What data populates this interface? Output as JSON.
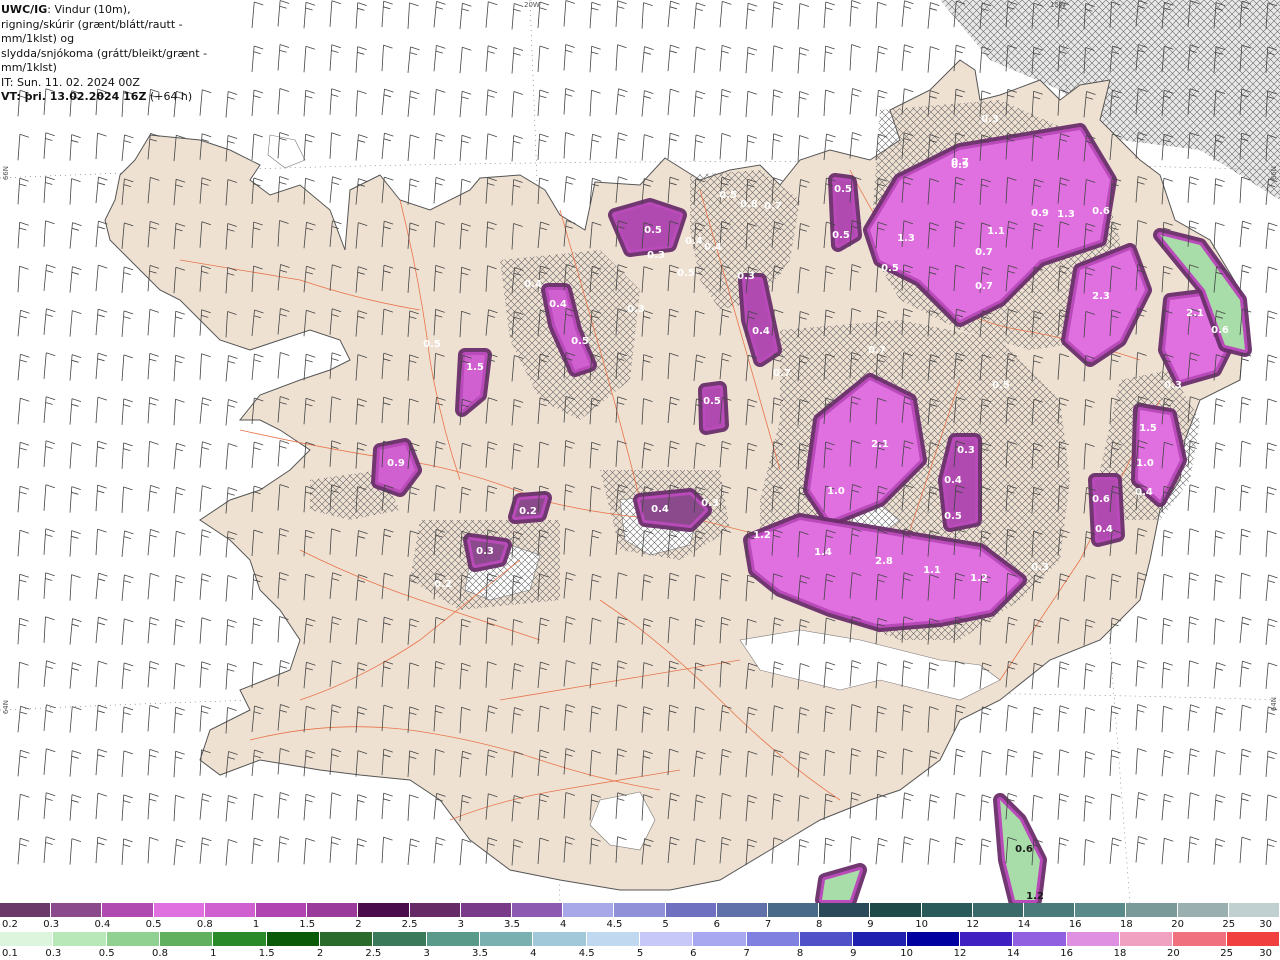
{
  "info": {
    "product": "UWC/IG",
    "line1_rest": ": Vindur (10m),",
    "line2": "rigning/skúrir (grænt/blátt/rautt - mm/1klst) og",
    "line3": "slydda/snjókoma (grátt/bleikt/grænt - mm/1klst)",
    "line4": "IT: Sun. 11. 02. 2024 00Z",
    "vt_label": "VT: þri. 13.02.2024 16Z",
    "vt_offset": " (+64 h)"
  },
  "grid_labels": {
    "lon_20w": "20W",
    "lon_15w": "15W",
    "lat_66n_left": "66N",
    "lat_66n_right": "66N",
    "lat_64n_left": "64N",
    "lat_64n_right": "64N"
  },
  "colors": {
    "land": "#efe1d2",
    "sea": "#ffffff",
    "coast": "#555555",
    "roads": "#e8744a",
    "snow_heavy": "#6b2e6b",
    "snow_mid": "#b94ab9",
    "snow_light": "#f07af0",
    "rain_light": "#a8dca8"
  },
  "precip_labels": [
    {
      "text": "0.3",
      "kind": "snow"
    },
    {
      "text": "0.9",
      "kind": "snow"
    },
    {
      "text": "0.7",
      "kind": "snow"
    },
    {
      "text": "1.1",
      "kind": "snow"
    },
    {
      "text": "1.3",
      "kind": "snow"
    },
    {
      "text": "0.9",
      "kind": "snow"
    },
    {
      "text": "0.6",
      "kind": "snow"
    },
    {
      "text": "1.3",
      "kind": "snow"
    },
    {
      "text": "0.5",
      "kind": "snow"
    },
    {
      "text": "0.7",
      "kind": "snow"
    },
    {
      "text": "0.7",
      "kind": "snow"
    },
    {
      "text": "2.3",
      "kind": "snow"
    },
    {
      "text": "2.1",
      "kind": "snow"
    },
    {
      "text": "0.6",
      "kind": "snow"
    },
    {
      "text": "0.3",
      "kind": "snow"
    },
    {
      "text": "0.7",
      "kind": "snow"
    },
    {
      "text": "2.1",
      "kind": "snow"
    },
    {
      "text": "1.0",
      "kind": "snow"
    },
    {
      "text": "0.3",
      "kind": "snow"
    },
    {
      "text": "0.4",
      "kind": "snow"
    },
    {
      "text": "0.5",
      "kind": "snow"
    },
    {
      "text": "1.5",
      "kind": "snow"
    },
    {
      "text": "1.0",
      "kind": "snow"
    },
    {
      "text": "0.4",
      "kind": "snow"
    },
    {
      "text": "0.6",
      "kind": "snow"
    },
    {
      "text": "0.4",
      "kind": "snow"
    },
    {
      "text": "1.2",
      "kind": "snow"
    },
    {
      "text": "1.4",
      "kind": "snow"
    },
    {
      "text": "2.8",
      "kind": "snow"
    },
    {
      "text": "1.1",
      "kind": "snow"
    },
    {
      "text": "1.2",
      "kind": "snow"
    },
    {
      "text": "0.3",
      "kind": "snow"
    },
    {
      "text": "0.5",
      "kind": "snow"
    },
    {
      "text": "0.8",
      "kind": "snow"
    },
    {
      "text": "0.7",
      "kind": "snow"
    },
    {
      "text": "0.5",
      "kind": "snow"
    },
    {
      "text": "0.5",
      "kind": "snow"
    },
    {
      "text": "0.3",
      "kind": "snow"
    },
    {
      "text": "0.4",
      "kind": "snow"
    },
    {
      "text": "0.4",
      "kind": "snow"
    },
    {
      "text": "0.5",
      "kind": "snow"
    },
    {
      "text": "0.3",
      "kind": "snow"
    },
    {
      "text": "0.5",
      "kind": "snow"
    },
    {
      "text": "0.3",
      "kind": "snow"
    },
    {
      "text": "0.5",
      "kind": "snow"
    },
    {
      "text": "0.4",
      "kind": "snow"
    },
    {
      "text": "0.7",
      "kind": "snow"
    },
    {
      "text": "0.3",
      "kind": "snow"
    },
    {
      "text": "0.4",
      "kind": "snow"
    },
    {
      "text": "0.2",
      "kind": "snow"
    },
    {
      "text": "0.3",
      "kind": "snow"
    },
    {
      "text": "0.2",
      "kind": "snow"
    },
    {
      "text": "0.9",
      "kind": "snow"
    },
    {
      "text": "1.5",
      "kind": "snow"
    },
    {
      "text": "0.4",
      "kind": "snow"
    },
    {
      "text": "0.5",
      "kind": "snow"
    },
    {
      "text": "0.4",
      "kind": "snow"
    },
    {
      "text": "0.5",
      "kind": "snow"
    },
    {
      "text": "0.5",
      "kind": "snow"
    },
    {
      "text": "0.6",
      "kind": "rain"
    },
    {
      "text": "1.2",
      "kind": "rain"
    }
  ],
  "legend_snow": {
    "labels": [
      "0.2",
      "0.3",
      "0.4",
      "0.5",
      "0.8",
      "1",
      "1.5",
      "2",
      "2.5",
      "3",
      "3.5",
      "4",
      "4.5",
      "5",
      "6",
      "7",
      "8",
      "9",
      "10",
      "12",
      "14",
      "16",
      "18",
      "20",
      "25",
      "30"
    ],
    "colors": [
      "#6b3a6b",
      "#8b4a8b",
      "#b04ab0",
      "#e070e0",
      "#d060d0",
      "#b044b0",
      "#9a3a9a",
      "#4a0c4a",
      "#662a66",
      "#7a3a8a",
      "#8c5ab0",
      "#a8a8e8",
      "#9090d8",
      "#7070c0",
      "#6070a8",
      "#4a6a8a",
      "#2a4a5a",
      "#1e4a4a",
      "#2a5a5a",
      "#3a6a6a",
      "#4a7a7a",
      "#5a8a8a",
      "#7a9a9a",
      "#9ab0b0",
      "#c0d0d0"
    ]
  },
  "legend_rain": {
    "labels": [
      "0.1",
      "0.3",
      "0.5",
      "0.8",
      "1",
      "1.5",
      "2",
      "2.5",
      "3",
      "3.5",
      "4",
      "4.5",
      "5",
      "6",
      "7",
      "8",
      "9",
      "10",
      "12",
      "14",
      "16",
      "18",
      "20",
      "25",
      "30"
    ],
    "colors": [
      "#ddf5dd",
      "#b8e8b8",
      "#90d090",
      "#60b060",
      "#2a8a2a",
      "#0a5a0a",
      "#2a6a2a",
      "#3a7a5a",
      "#5a9a8a",
      "#7ab0b0",
      "#a0c8d8",
      "#c0d8f0",
      "#c8c8f8",
      "#a8a8f0",
      "#8080e0",
      "#5050c8",
      "#2020b0",
      "#0000a0",
      "#4020c0",
      "#9060e0",
      "#e090e0",
      "#f0a0c0",
      "#f07080",
      "#f04040"
    ]
  }
}
